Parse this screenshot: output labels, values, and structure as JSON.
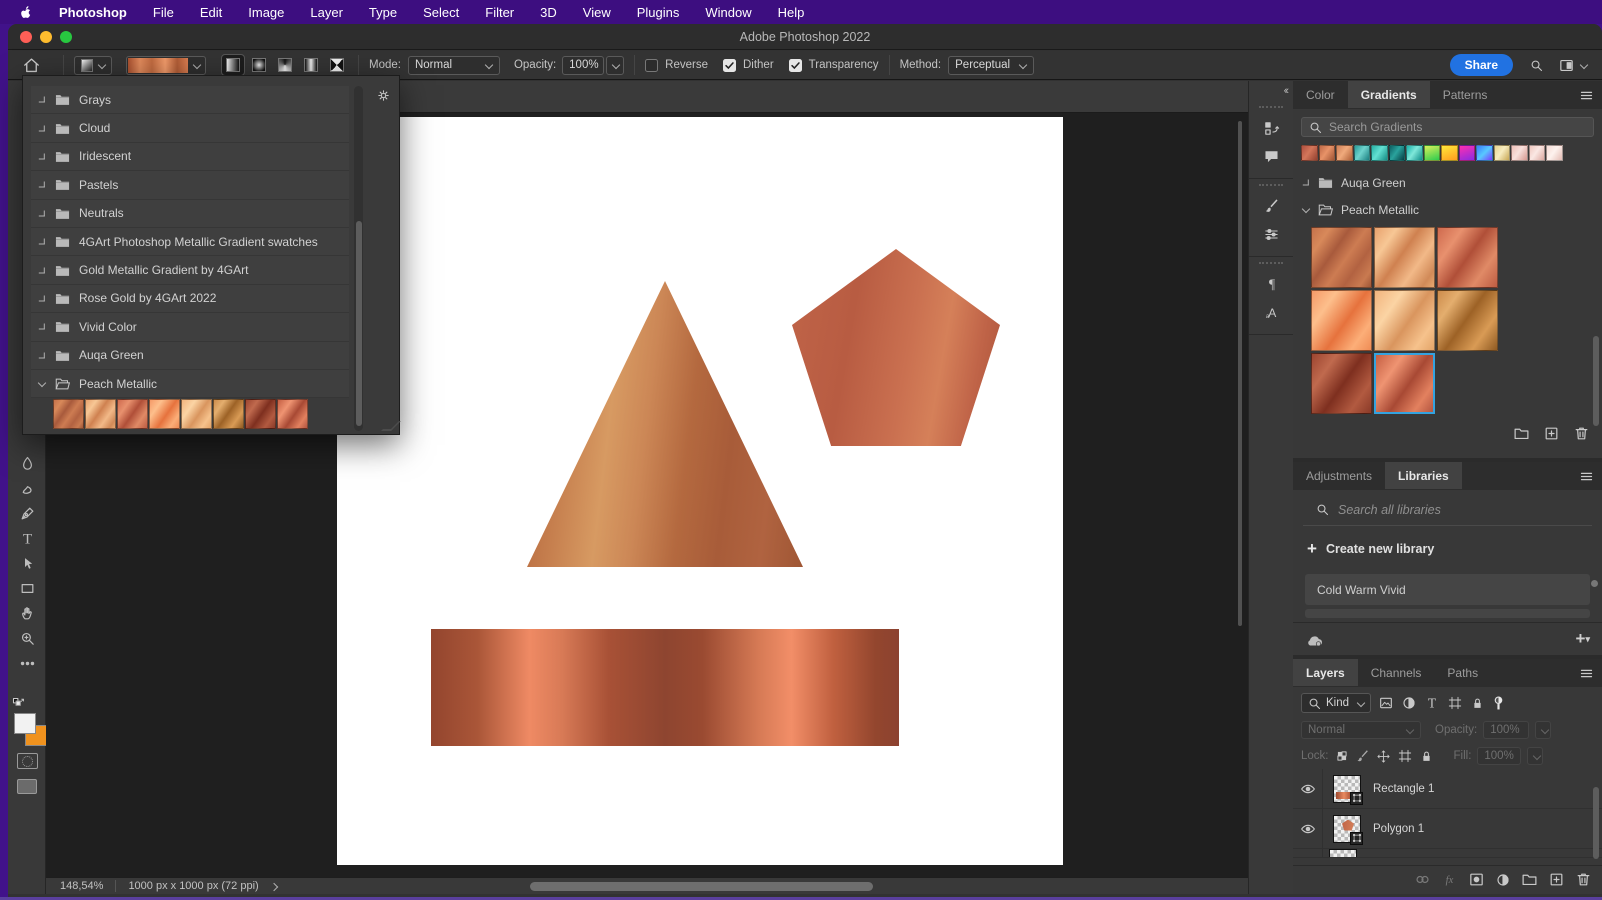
{
  "menubar": {
    "items": [
      "Photoshop",
      "File",
      "Edit",
      "Image",
      "Layer",
      "Type",
      "Select",
      "Filter",
      "3D",
      "View",
      "Plugins",
      "Window",
      "Help"
    ]
  },
  "titlebar": {
    "title": "Adobe Photoshop 2022"
  },
  "options_bar": {
    "mode_label": "Mode:",
    "mode_value": "Normal",
    "opacity_label": "Opacity:",
    "opacity_value": "100%",
    "reverse_label": "Reverse",
    "dither_label": "Dither",
    "transparency_label": "Transparency",
    "method_label": "Method:",
    "method_value": "Perceptual",
    "share_label": "Share",
    "reverse_checked": false,
    "dither_checked": true,
    "transparency_checked": true,
    "preview_gradient": "linear-gradient(90deg,#a8502f 0%,#e08a5c 20%,#c06a40 40%,#f09a6a 62%,#b05c36 82%,#d87c50 100%)"
  },
  "gradient_picker": {
    "folders": [
      "Grays",
      "Cloud",
      "Iridescent",
      "Pastels",
      "Neutrals",
      "4GArt Photoshop Metallic Gradient swatches",
      "Gold Metallic Gradient by 4GArt",
      "Rose Gold by 4GArt 2022",
      "Vivid Color",
      "Auqa Green"
    ],
    "expanded_folder": "Peach Metallic"
  },
  "peach_swatches": [
    "linear-gradient(125deg,#c5724b 0%,#d8895a 18%,#a85a3c 38%,#cd7c52 55%,#b26241 72%,#c97a50 88%,#9e5636 100%)",
    "linear-gradient(125deg,#e8a26e 0%,#f7c795 22%,#cf8150 45%,#f2b988 68%,#d18a58 88%,#e8a870 100%)",
    "linear-gradient(125deg,#cf6a4e 0%,#e8916e 25%,#b04f38 50%,#e08a66 75%,#bd5c42 100%)",
    "linear-gradient(125deg,#f59a68 0%,#fdbf8c 25%,#e6723d 55%,#fcae78 80%,#ef8c55 100%)",
    "linear-gradient(125deg,#f2b47e 0%,#fbd4a4 28%,#d9955e 55%,#f6c28c 80%,#e3a468 100%)",
    "linear-gradient(125deg,#cd8c4c 0%,#e4ae6e 22%,#9d6226 48%,#d99b55 75%,#8f5a22 100%)",
    "linear-gradient(125deg,#9c4530 0%,#c06a4e 25%,#7e2f1f 52%,#b25a40 78%,#8a3a28 100%)",
    "linear-gradient(125deg,#c55f43 0%,#ef9472 28%,#a84934 55%,#e3815f 80%,#b35540 100%)"
  ],
  "gradients_panel": {
    "tabs": [
      "Color",
      "Gradients",
      "Patterns"
    ],
    "active_tab": "Gradients",
    "search_placeholder": "Search Gradients",
    "strip_swatches": [
      "linear-gradient(125deg,#b05040,#d4765a 45%,#93402f)",
      "linear-gradient(125deg,#c06a48,#e89368 45%,#a05434)",
      "linear-gradient(125deg,#d08058,#f0aa7c 45%,#b06038)",
      "linear-gradient(125deg,#2a9d9b,#6fd3cd 45%,#1b7f80)",
      "linear-gradient(125deg,#27b1a5,#63e0d2 45%,#148c84)",
      "linear-gradient(125deg,#0d5f63,#2aa39d 45%,#063f44)",
      "linear-gradient(125deg,#17b2aa,#7fe8da 45%,#0f8d88)",
      "linear-gradient(160deg,#d8f05a 0%,#2ecc4e 100%)",
      "linear-gradient(160deg,#ffe83a 0%,#ff9d1f 100%)",
      "linear-gradient(160deg,#ff2fb0 0%,#8a2be2 100%)",
      "linear-gradient(135deg,#3a7bff,#58c9ff 50%,#7a3bff)",
      "linear-gradient(125deg,#e8d490,#f7ecc0 45%,#c8a855)",
      "linear-gradient(125deg,#eec0b8,#f8e0dc 45%,#d89890)",
      "linear-gradient(125deg,#f0c8c0,#fae8e4 45%,#dca8a0)",
      "linear-gradient(125deg,#f6dcd6,#fdf2ee 45%,#e4bcb4)"
    ],
    "folders": [
      {
        "name": "Auqa Green",
        "expanded": false
      },
      {
        "name": "Peach Metallic",
        "expanded": true
      }
    ],
    "selected_index": 7
  },
  "libraries_panel": {
    "tabs": [
      "Adjustments",
      "Libraries"
    ],
    "active_tab": "Libraries",
    "search_placeholder": "Search all libraries",
    "create_label": "Create new library",
    "items": [
      "Cold Warm Vivid"
    ]
  },
  "layers_panel": {
    "tabs": [
      "Layers",
      "Channels",
      "Paths"
    ],
    "active_tab": "Layers",
    "filter_label": "Kind",
    "blend_mode": "Normal",
    "opacity_label": "Opacity:",
    "opacity_value": "100%",
    "lock_label": "Lock:",
    "fill_label": "Fill:",
    "fill_value": "100%",
    "layers": [
      {
        "name": "Rectangle 1",
        "shape": "rect"
      },
      {
        "name": "Polygon 1",
        "shape": "pentagon"
      }
    ]
  },
  "status_bar": {
    "zoom": "148,54%",
    "doc_info": "1000 px x 1000 px (72 ppi)"
  },
  "canvas_shapes": {
    "triangle_gradient": "linear-gradient(97deg,#b06038 0%,#c67f4e 18%,#d79a62 32%,#cc8756 44%,#b4693f 58%,#a85c39 72%,#b06340 86%,#9f5634 100%)",
    "pentagon_gradient": "linear-gradient(100deg,#c06448 0%,#b85c42 30%,#ca7050 55%,#d58059 70%,#c06448 85%,#aa5238 100%)",
    "rectangle_gradient": "linear-gradient(90deg,#93452e 0%,#aa5638 10%,#ef8a64 21%,#d87a56 28%,#a85136 38%,#8e4530 50%,#9a4a31 58%,#d67a55 70%,#f28e68 77%,#c0603f 86%,#93462e 95%,#8c4230 100%)"
  },
  "colors": {
    "accent_blue": "#2172e2",
    "selection_cyan": "#33a3e0",
    "menubar_purple": "#3d0e80",
    "bg_color_chip": "#f0921e"
  },
  "toolbar_tools": [
    "blur-tool",
    "smudge-tool",
    "pen-tool",
    "type-tool",
    "path-select-tool",
    "rectangle-tool",
    "hand-tool",
    "zoom-tool",
    "more-tools"
  ],
  "dock_icons": [
    [
      "history",
      "comments"
    ],
    [
      "brush-settings",
      "clone-source"
    ],
    [
      "paragraph",
      "character"
    ]
  ]
}
